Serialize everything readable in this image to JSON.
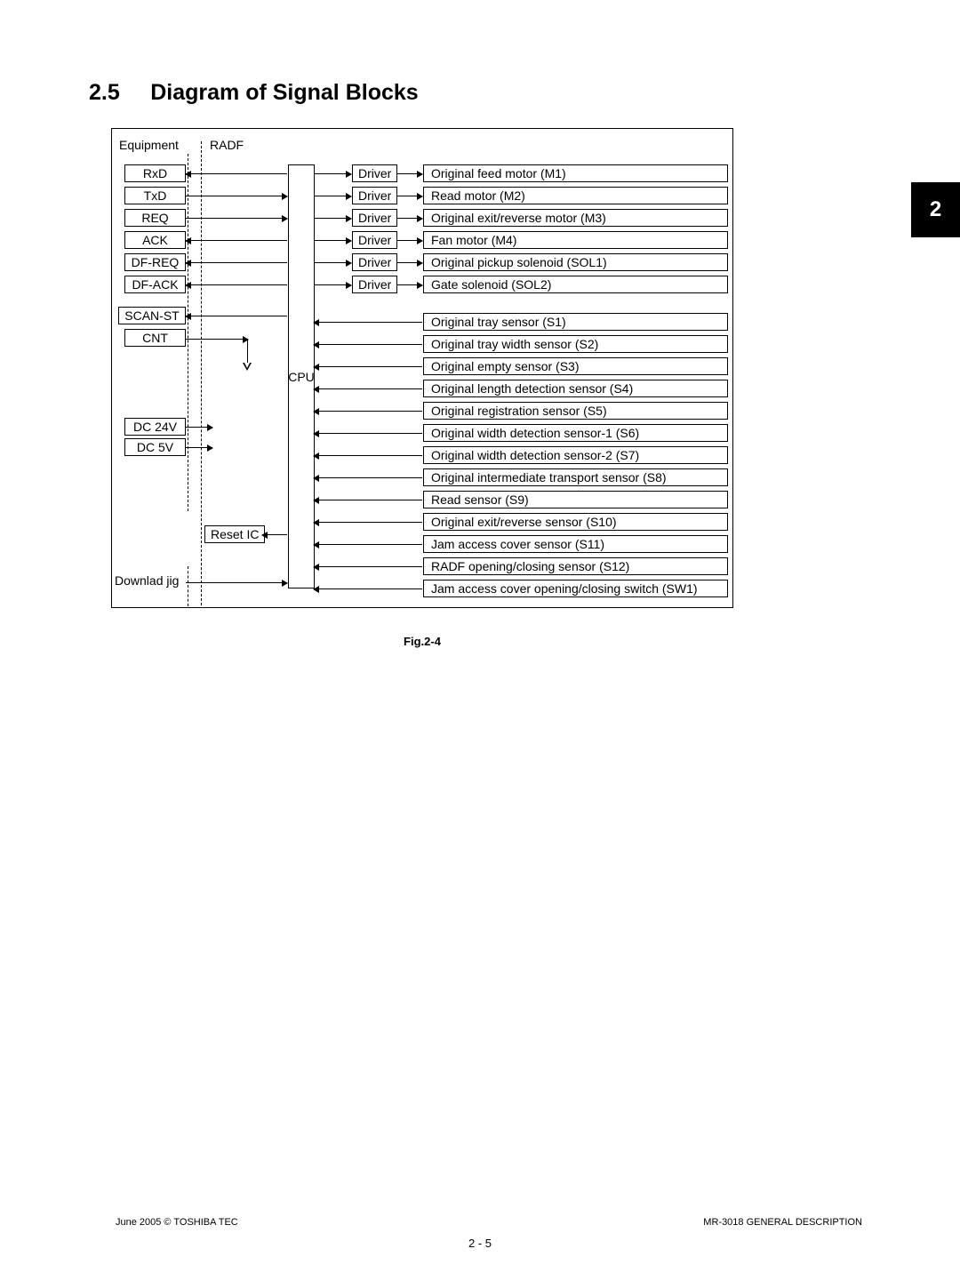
{
  "section": {
    "number": "2.5",
    "title": "Diagram of Signal Blocks"
  },
  "chapter_tab": "2",
  "diagram": {
    "equipment_label": "Equipment",
    "radf_label": "RADF",
    "cpu_label": "CPU",
    "reset_ic_label": "Reset IC",
    "download_jig_label": "Downlad jig",
    "left_signals": [
      "RxD",
      "TxD",
      "REQ",
      "ACK",
      "DF-REQ",
      "DF-ACK",
      "SCAN-ST",
      "CNT"
    ],
    "power_signals": [
      "DC 24V",
      "DC 5V"
    ],
    "driver_label": "Driver",
    "driver_targets": [
      "Original feed motor (M1)",
      "Read motor (M2)",
      "Original exit/reverse motor (M3)",
      "Fan motor (M4)",
      "Original pickup solenoid (SOL1)",
      "Gate solenoid (SOL2)"
    ],
    "sensors": [
      "Original tray sensor (S1)",
      "Original tray width sensor (S2)",
      "Original empty sensor (S3)",
      "Original length detection sensor (S4)",
      "Original registration sensor (S5)",
      "Original width detection sensor-1 (S6)",
      "Original width detection sensor-2 (S7)",
      "Original intermediate transport sensor (S8)",
      "Read sensor (S9)",
      "Original exit/reverse sensor (S10)",
      "Jam access cover sensor (S11)",
      "RADF opening/closing sensor (S12)",
      "Jam access cover opening/closing switch (SW1)"
    ]
  },
  "figure_label": "Fig.2-4",
  "footer": {
    "left": "June 2005 © TOSHIBA TEC",
    "right": "MR-3018 GENERAL DESCRIPTION",
    "page": "2 - 5"
  }
}
